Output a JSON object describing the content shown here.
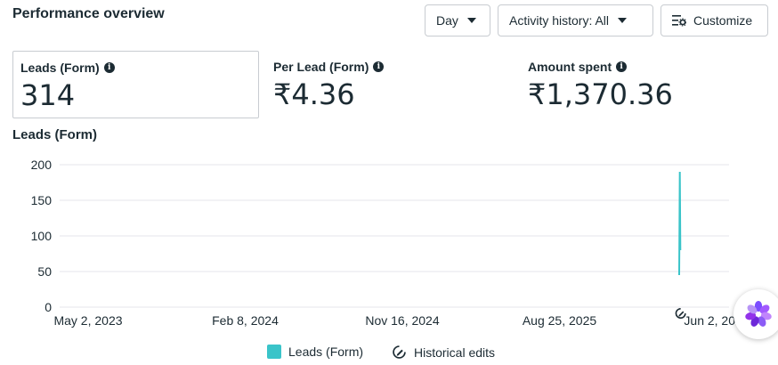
{
  "header": {
    "title": "Performance overview"
  },
  "controls": {
    "day_label": "Day",
    "activity_label": "Activity history: All",
    "customize_label": "Customize"
  },
  "metrics": [
    {
      "label": "Leads (Form)",
      "value": "314"
    },
    {
      "label": "Per Lead (Form)",
      "value": "₹4.36"
    },
    {
      "label": "Amount spent",
      "value": "₹1,370.36"
    }
  ],
  "chart_title": "Leads (Form)",
  "legend": {
    "series": "Leads (Form)",
    "edits": "Historical edits"
  },
  "colors": {
    "series": "#3ac4c9",
    "grid": "#e4e6eb",
    "text": "#1c2b33"
  },
  "chart_data": {
    "type": "line",
    "title": "Leads (Form)",
    "ylim": [
      0,
      200
    ],
    "y_ticks": [
      0,
      50,
      100,
      150,
      200
    ],
    "x_ticks": [
      "May 2, 2023",
      "Feb 8, 2024",
      "Nov 16, 2024",
      "Aug 25, 2025",
      "Jun 2, 2026"
    ],
    "x_range": [
      "2023-05-02",
      "2026-06-02"
    ],
    "series": [
      {
        "name": "Leads (Form)",
        "points": [
          {
            "x": "2026-03-27",
            "y": 45
          },
          {
            "x": "2026-03-28",
            "y": 190
          },
          {
            "x": "2026-03-29",
            "y": 80
          }
        ]
      }
    ],
    "historical_edits": [
      "2026-03-28"
    ],
    "grid": true,
    "legend_position": "bottom"
  }
}
